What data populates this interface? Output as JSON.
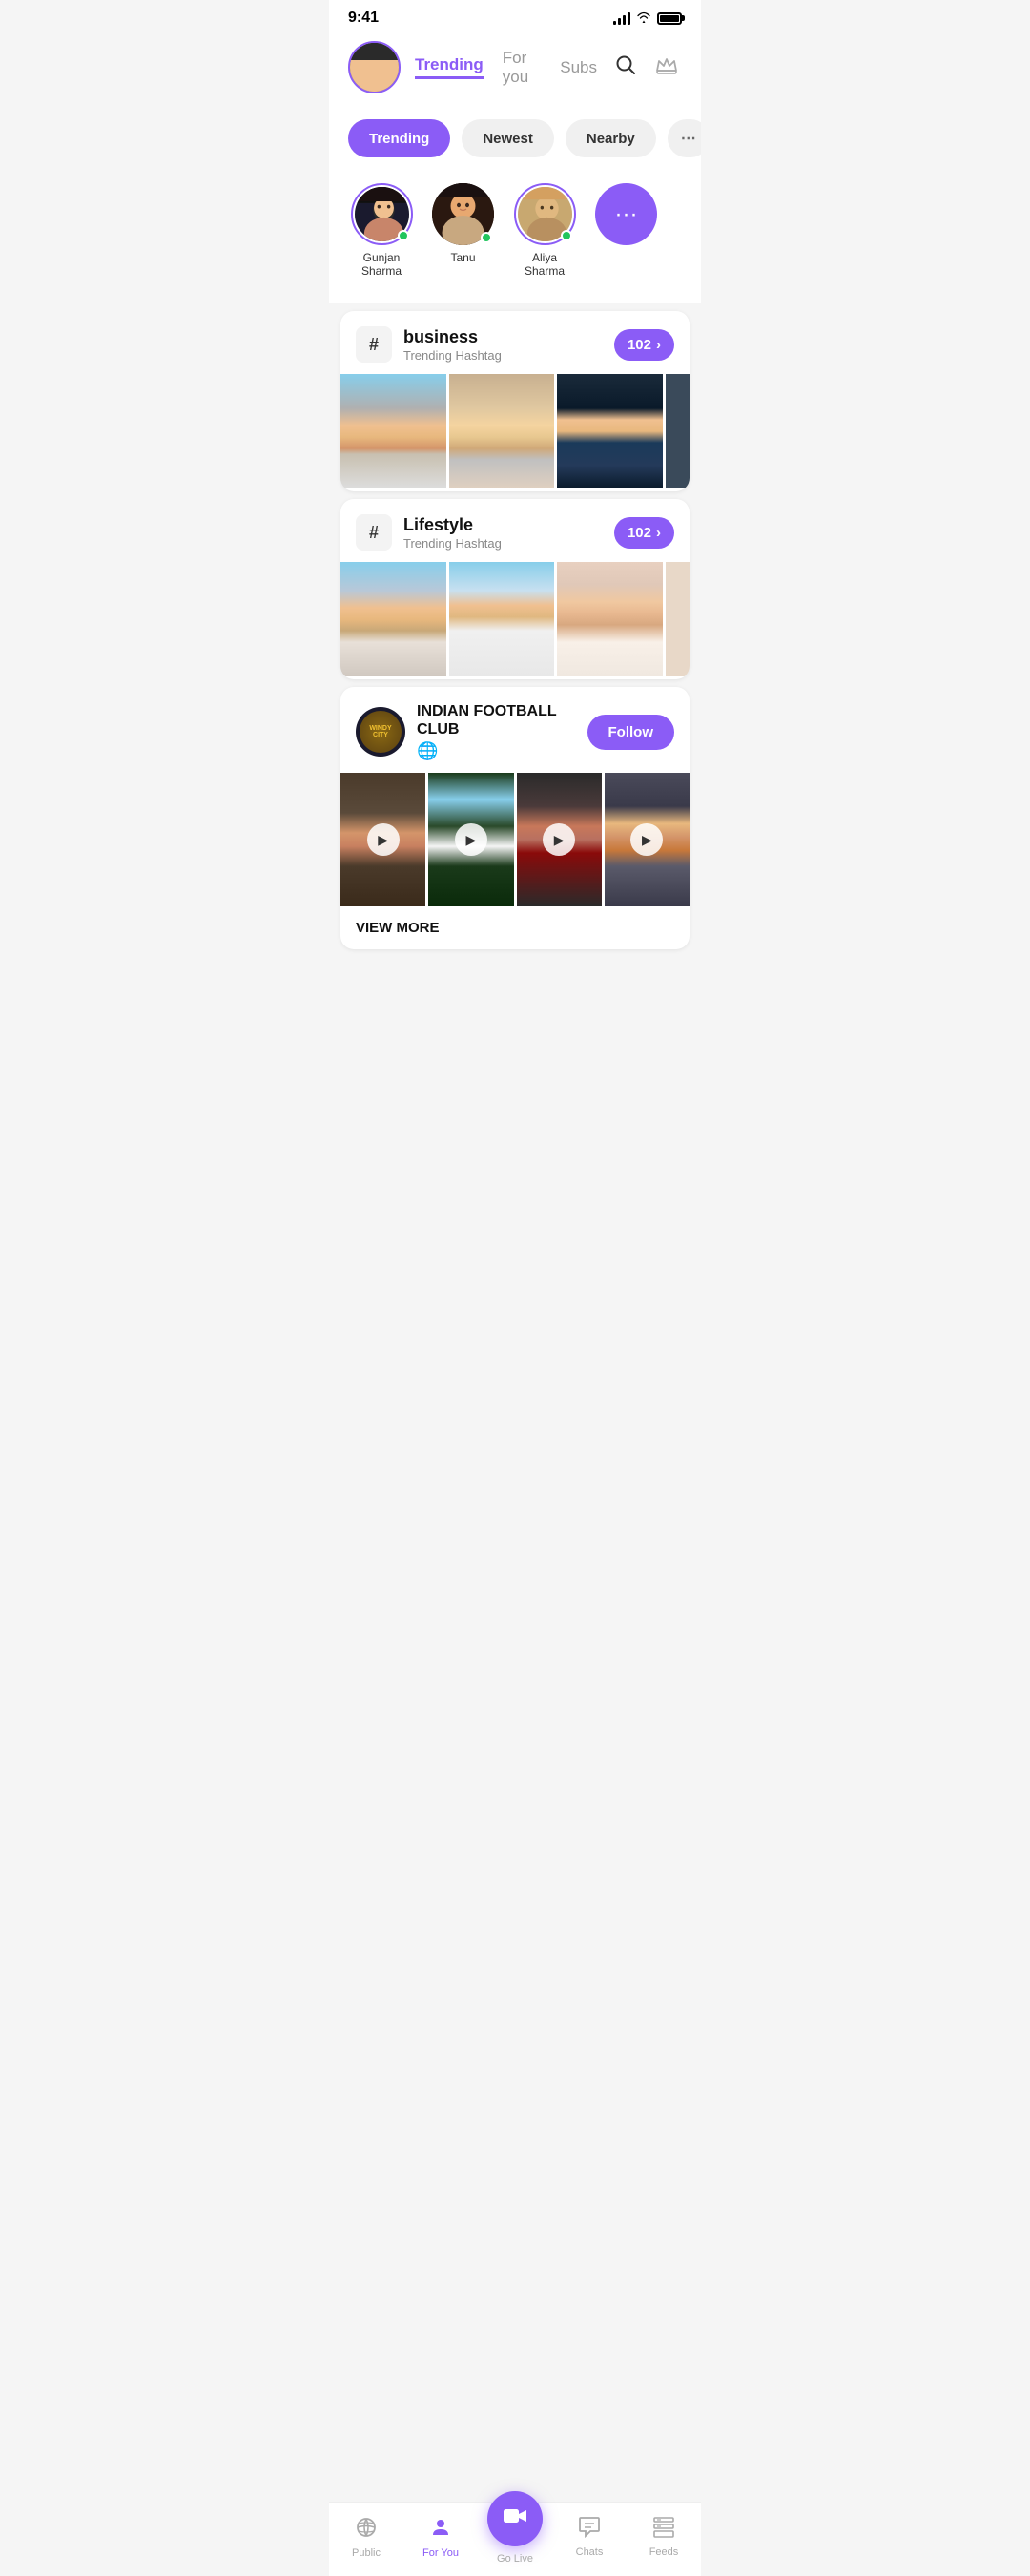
{
  "statusBar": {
    "time": "9:41"
  },
  "header": {
    "trendingLabel": "Trending",
    "forYouLabel": "For you",
    "subsLabel": "Subs",
    "activeTab": "Trending"
  },
  "filterTabs": [
    {
      "label": "Trending",
      "active": true
    },
    {
      "label": "Newest",
      "active": false
    },
    {
      "label": "Nearby",
      "active": false
    }
  ],
  "stories": [
    {
      "name": "Gunjan Sharma",
      "online": true
    },
    {
      "name": "Tanu",
      "online": true
    },
    {
      "name": "Aliya Sharma",
      "online": true
    }
  ],
  "hashtagSections": [
    {
      "tag": "business",
      "subtext": "Trending Hashtag",
      "count": "102"
    },
    {
      "tag": "Lifestyle",
      "subtext": "Trending Hashtag",
      "count": "102"
    }
  ],
  "clubSection": {
    "clubName": "INDIAN FOOTBALL CLUB",
    "logoText": "WINDY\ncity",
    "followLabel": "Follow",
    "viewMoreLabel": "VIEW MORE"
  },
  "bottomNav": [
    {
      "label": "Public",
      "icon": "📡",
      "active": false
    },
    {
      "label": "For You",
      "icon": "👤",
      "active": true
    },
    {
      "label": "Go Live",
      "icon": "🎥",
      "active": false,
      "isCenter": true
    },
    {
      "label": "Chats",
      "icon": "💬",
      "active": false
    },
    {
      "label": "Feeds",
      "icon": "📋",
      "active": false
    }
  ]
}
